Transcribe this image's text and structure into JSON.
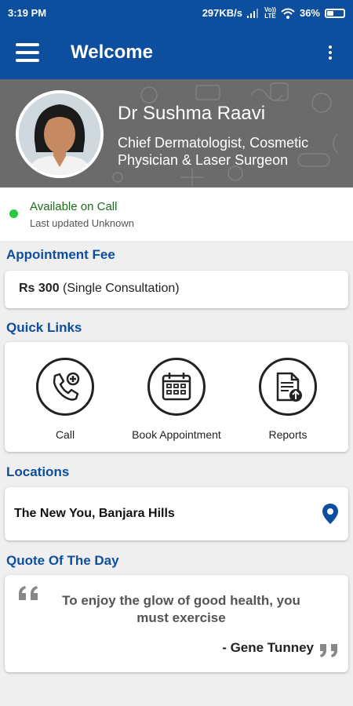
{
  "status_bar": {
    "time": "3:19 PM",
    "speed": "297KB/s",
    "volte_top": "Vo))",
    "volte_bottom": "LTE",
    "battery": "36%"
  },
  "app_bar": {
    "title": "Welcome"
  },
  "profile": {
    "name": "Dr Sushma Raavi",
    "title": "Chief Dermatologist, Cosmetic Physician & Laser Surgeon"
  },
  "availability": {
    "status": "Available on Call",
    "last_updated": "Last updated Unknown"
  },
  "appointment_fee": {
    "heading": "Appointment Fee",
    "amount": "Rs 300",
    "note": "(Single Consultation)"
  },
  "quick_links": {
    "heading": "Quick Links",
    "items": [
      {
        "label": "Call",
        "icon": "phone-plus-icon"
      },
      {
        "label": "Book Appointment",
        "icon": "calendar-icon"
      },
      {
        "label": "Reports",
        "icon": "document-upload-icon"
      }
    ]
  },
  "locations": {
    "heading": "Locations",
    "items": [
      {
        "name": "The New You, Banjara Hills",
        "icon": "map-pin-icon"
      }
    ]
  },
  "quote": {
    "heading": "Quote Of The Day",
    "text": "To enjoy the glow of good health, you must exercise",
    "author": "- Gene Tunney"
  },
  "colors": {
    "primary": "#0d4f9e",
    "available": "#27c93f",
    "background": "#efefef"
  }
}
